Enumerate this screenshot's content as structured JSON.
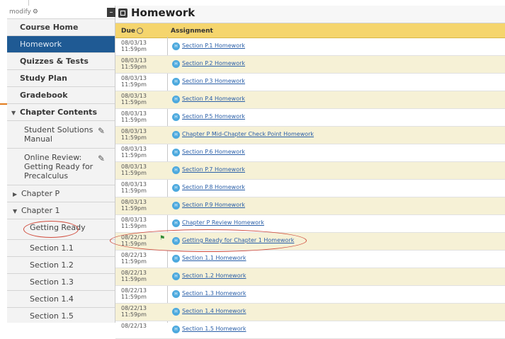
{
  "header": {
    "modify_label": "modify",
    "title": "Homework"
  },
  "table": {
    "col_due": "Due",
    "col_assignment": "Assignment"
  },
  "sidebar": {
    "main_items": [
      {
        "label": "Course Home"
      },
      {
        "label": "Homework",
        "active": true
      },
      {
        "label": "Quizzes & Tests"
      },
      {
        "label": "Study Plan"
      },
      {
        "label": "Gradebook"
      }
    ],
    "chapter_contents": "Chapter Contents",
    "student_solutions": "Student Solutions Manual",
    "online_review": "Online Review: Getting Ready for Precalculus",
    "chapter_p": "Chapter P",
    "chapter_1": "Chapter 1",
    "getting_ready": "Getting Ready",
    "sections": [
      "Section 1.1",
      "Section 1.2",
      "Section 1.3",
      "Section 1.4",
      "Section 1.5"
    ]
  },
  "rows": [
    {
      "date": "08/03/13",
      "time": "11:59pm",
      "assignment": "Section P.1 Homework"
    },
    {
      "date": "08/03/13",
      "time": "11:59pm",
      "assignment": "Section P.2 Homework"
    },
    {
      "date": "08/03/13",
      "time": "11:59pm",
      "assignment": "Section P.3 Homework"
    },
    {
      "date": "08/03/13",
      "time": "11:59pm",
      "assignment": "Section P.4 Homework"
    },
    {
      "date": "08/03/13",
      "time": "11:59pm",
      "assignment": "Section P.5 Homework"
    },
    {
      "date": "08/03/13",
      "time": "11:59pm",
      "assignment": "Chapter P Mid-Chapter Check Point Homework"
    },
    {
      "date": "08/03/13",
      "time": "11:59pm",
      "assignment": "Section P.6 Homework"
    },
    {
      "date": "08/03/13",
      "time": "11:59pm",
      "assignment": "Section P.7 Homework"
    },
    {
      "date": "08/03/13",
      "time": "11:59pm",
      "assignment": "Section P.8 Homework"
    },
    {
      "date": "08/03/13",
      "time": "11:59pm",
      "assignment": "Section P.9 Homework"
    },
    {
      "date": "08/03/13",
      "time": "11:59pm",
      "assignment": "Chapter P Review Homework"
    },
    {
      "date": "08/22/13",
      "time": "11:59pm",
      "assignment": "Getting Ready for Chapter 1 Homework",
      "flag": true
    },
    {
      "date": "08/22/13",
      "time": "11:59pm",
      "assignment": "Section 1.1 Homework"
    },
    {
      "date": "08/22/13",
      "time": "11:59pm",
      "assignment": "Section 1.2 Homework"
    },
    {
      "date": "08/22/13",
      "time": "11:59pm",
      "assignment": "Section 1.3 Homework"
    },
    {
      "date": "08/22/13",
      "time": "11:59pm",
      "assignment": "Section 1.4 Homework"
    },
    {
      "date": "08/22/13",
      "time": "",
      "assignment": "Section 1.5 Homework"
    }
  ],
  "colors": {
    "active_nav": "#1f5a94",
    "header_row": "#f5d56d",
    "alt_row": "#f6f1d6",
    "link": "#2a5fa8",
    "annotation": "#d04a3b"
  },
  "icons": {
    "gear": "gear-icon",
    "collapse": "collapse-icon",
    "clock": "clock-icon",
    "pen": "pencil-off-icon",
    "flag": "flag-icon",
    "hw": "homework-badge-icon"
  }
}
